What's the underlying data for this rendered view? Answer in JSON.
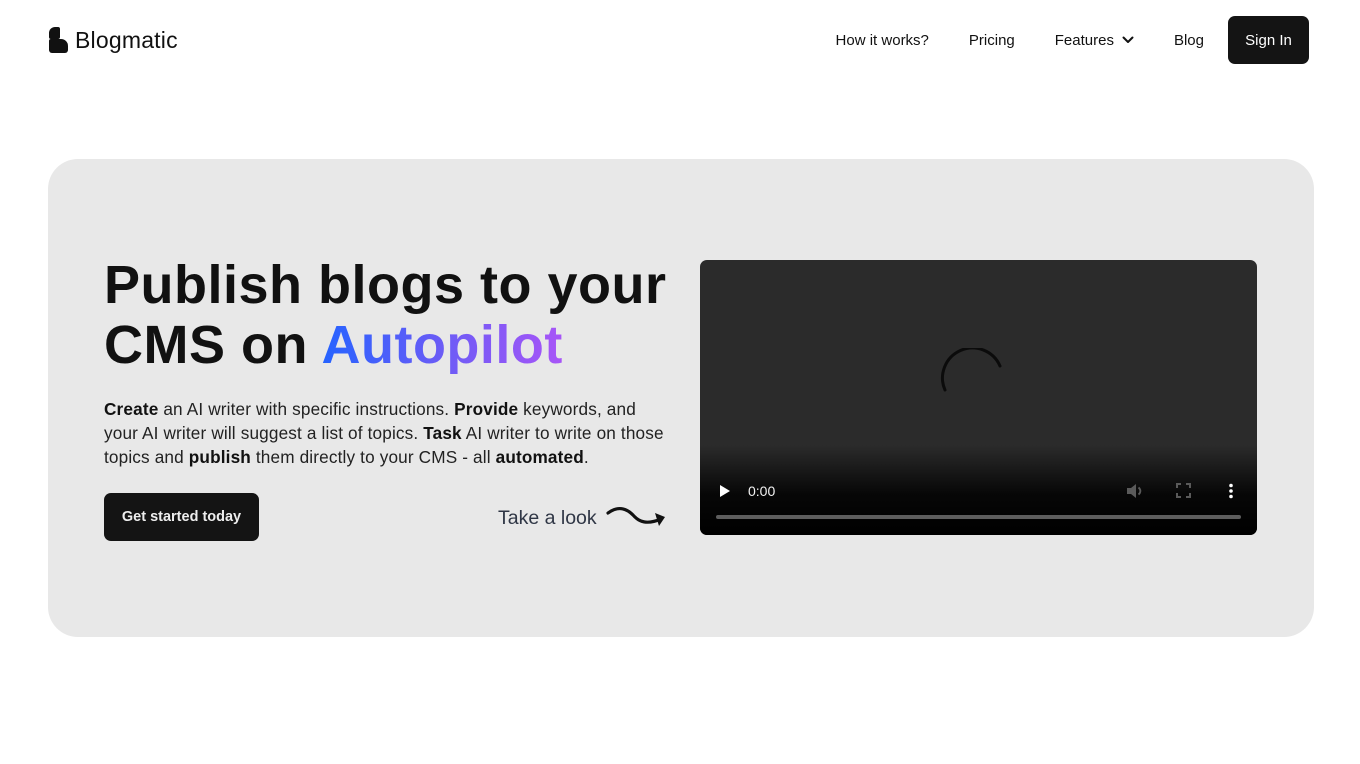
{
  "header": {
    "logo_text": "Blogmatic",
    "nav": [
      {
        "label": "How it works?"
      },
      {
        "label": "Pricing"
      },
      {
        "label": "Features",
        "icon": "chevron-down-icon"
      },
      {
        "label": "Blog"
      }
    ],
    "signin_label": "Sign In"
  },
  "hero": {
    "title_line1": "Publish blogs to your",
    "title_line2_prefix": "CMS on ",
    "title_highlight": "Autopilot",
    "highlight_gradient": [
      "#2563ff",
      "#a855f7"
    ],
    "description": [
      {
        "text": "Create",
        "bold": true
      },
      {
        "text": " an AI writer with specific instructions. ",
        "bold": false
      },
      {
        "text": "Provide",
        "bold": true
      },
      {
        "text": " keywords, and your AI writer will suggest a list of topics. ",
        "bold": false
      },
      {
        "text": "Task",
        "bold": true
      },
      {
        "text": " AI writer to write on those topics and ",
        "bold": false
      },
      {
        "text": "publish",
        "bold": true
      },
      {
        "text": " them directly to your CMS - all ",
        "bold": false
      },
      {
        "text": "automated",
        "bold": true
      },
      {
        "text": ".",
        "bold": false
      }
    ],
    "cta_label": "Get started today",
    "look_label": "Take a look",
    "look_icon": "squiggle-arrow-icon"
  },
  "video": {
    "state": "loading",
    "current_time": "0:00",
    "progress": 0,
    "icons": [
      "play-icon",
      "volume-icon",
      "fullscreen-icon",
      "more-options-icon",
      "loading-spinner-icon"
    ]
  }
}
